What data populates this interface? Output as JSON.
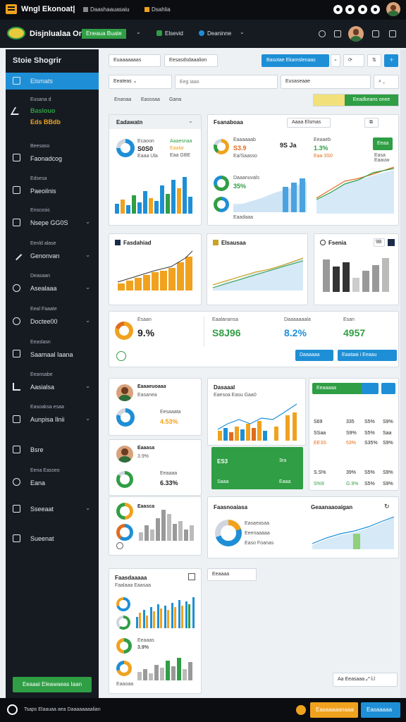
{
  "topbar": {
    "app_title": "Wngl Ekonoat|",
    "link1": "Daashaauasaiu",
    "link2": "Dsahlia"
  },
  "header": {
    "title": "Disjnlualaa Ona",
    "badge": "Eneaua Buate",
    "item1": "Elsevid",
    "item2": "Deaninne"
  },
  "sidebar": {
    "title": "Stoie Shogrir",
    "items": [
      {
        "label": "Elsmats",
        "sub": ""
      },
      {
        "label": "Baslouo",
        "sub": "Eusana d",
        "value": "Eds BBdb"
      },
      {
        "label": "Faonadcog",
        "sub": "Beesaso"
      },
      {
        "label": "Paeoilnis",
        "sub": "Edsesa"
      },
      {
        "label": "Nsepe GG0S",
        "sub": "Enscosic"
      },
      {
        "label": "Genonvan",
        "sub": "Eenld alase"
      },
      {
        "label": "Asealaaa",
        "sub": "Deasaan"
      },
      {
        "label": "Doctee00",
        "sub": "Eeal Faaate"
      },
      {
        "label": "Saamaal Iaana",
        "sub": "Eeaslasn"
      },
      {
        "label": "Aasialsa",
        "sub": "Eeansabe"
      },
      {
        "label": "Aunpisa Ilnii",
        "sub": "Easoaksa esaa"
      },
      {
        "label": "Bsre",
        "sub": ""
      },
      {
        "label": "Eana",
        "sub": "Eena Easseo"
      },
      {
        "label": "Sseeaat",
        "sub": ""
      },
      {
        "label": "Sueenat",
        "sub": ""
      }
    ],
    "bottom_button": "Eeaaai Eleawaeas Iaan"
  },
  "toolbar": {
    "filter1": "Euaaaaaaas",
    "filter2": "Eesasdsdaaalion",
    "primary": "Basotae Ekamslenaas",
    "select": "Eeateas",
    "search_placeholder": "Eeg laao",
    "dropdown2": "Eusaseaae",
    "green_label": "Eeadkeans onee"
  },
  "tabs": [
    "Enanaa",
    "Easssaa",
    "Gana"
  ],
  "cards": {
    "c1": {
      "title": "Eadawatn",
      "v1": "Ecaoon",
      "v2": "S0S0",
      "v3": "Eaaa Ula",
      "v4": "Aaaesnaa",
      "v5": "Eaalar",
      "v6": "Eaa GBE"
    },
    "c2": {
      "title": "Fsanaboaa",
      "pill": "Aaaa Elsmas",
      "v1": "Eaaaaaab",
      "v2": "S3.9",
      "v3": "Ea/Saasso",
      "v4": "9S Ja",
      "v5": "Eeaaeb",
      "v6": "1.3%",
      "v7": "Eaa 3S0",
      "v8": "Daaanuvals",
      "v9": "35%",
      "v10": "Eaadaaa",
      "btn": "Eeaa",
      "label": "Easa Eaauw"
    },
    "c3": {
      "title": "Fasdahiad"
    },
    "c4": {
      "title": "Elsausaa"
    },
    "c5": {
      "title": "Fsenia",
      "pill": "9B"
    },
    "kpis": {
      "k1": "9.%",
      "k1l": "Esaan",
      "k2": "S8J96",
      "k2l": "Eaalanansa",
      "k3": "8.2%",
      "k3l": "Daaaaaaala",
      "k4": "4957",
      "k4l": "Esan",
      "btn1": "Daaaaaa",
      "btn2": "Eaataai i Eeaau"
    },
    "p1": {
      "name": "Eaaaeuoaaa",
      "v": "Easanea",
      "sub": "Eesaaata",
      "pct": "88%",
      "pct2": "4.53%"
    },
    "p2": {
      "name": "Eaaasa",
      "v": "3.9%",
      "sub": "Eeaaaa",
      "pct": "Eaaaaa",
      "pct2": "6.33%"
    },
    "p3": {
      "name": "Eaasca"
    },
    "c6": {
      "title": "Dasaaal",
      "sub": "Eaesoa Easu Gaa0"
    },
    "green": {
      "v1": "ES3",
      "v2": "3ra",
      "v3": "Saaa",
      "v4": "Eaaa"
    },
    "table": {
      "pill": "Eeaaaaa",
      "rows": [
        [
          "S69",
          "335",
          "S5%",
          "S9%"
        ],
        [
          "SSaa",
          "S9%",
          "S5%",
          "Saa"
        ],
        [
          "EE3S",
          "53%",
          "S35%",
          "S9%"
        ],
        [
          "S.S%",
          "39%",
          "S5%",
          "S9%"
        ],
        [
          "S%9",
          "G.9%",
          "S5%",
          "S9%"
        ]
      ]
    },
    "c7": {
      "title": "Faasnoaiasa",
      "l1": "Easaeasaa",
      "l2": "Eeenaaaaa",
      "l3": "Easo Foanas"
    },
    "c8": {
      "title": "Geaanaaoaigan"
    },
    "c9": {
      "title": "Faasdaaaaa",
      "sub": "Faalaaa Eaasaa",
      "v1": "Eeaaas",
      "v2": "3.9%",
      "v3": "Eaaoaa"
    },
    "c10": {
      "label": "Eeaaaa"
    },
    "corner": {
      "label": "Aa Eeasaaa"
    }
  },
  "footer": {
    "text": "Tsaps Elaauaa aea Daaaaaaaalian",
    "btn1": "Easaaaaanaaa",
    "btn2": "Easaaaaa"
  }
}
